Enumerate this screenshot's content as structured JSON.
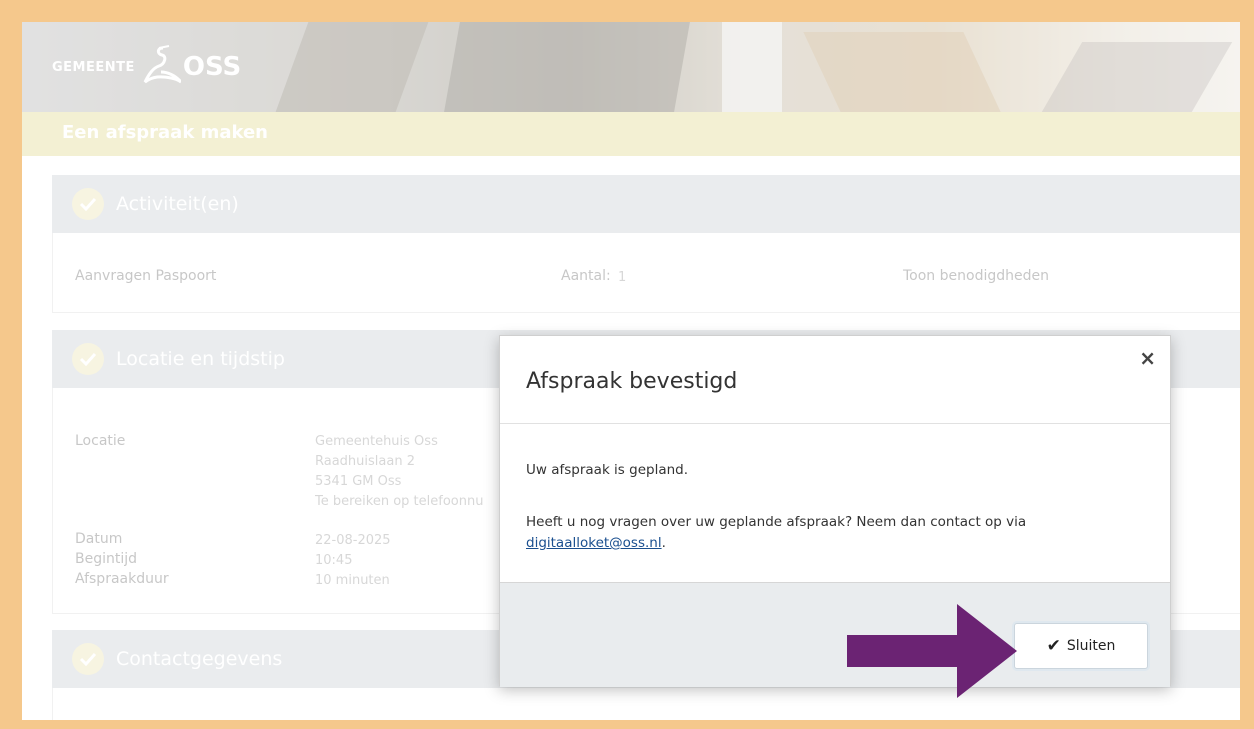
{
  "header": {
    "logo_small": "GEMEENTE",
    "logo_big": "OSS"
  },
  "page_title": "Een afspraak maken",
  "sections": {
    "activities": {
      "title": "Activiteit(en)",
      "item_label": "Aanvragen Paspoort",
      "count_label": "Aantal:",
      "count_value": "1",
      "link": "Toon benodigdheden"
    },
    "location": {
      "title": "Locatie en tijdstip",
      "location_label": "Locatie",
      "location_lines": [
        "Gemeentehuis Oss",
        "Raadhuislaan 2",
        "5341 GM Oss",
        "Te bereiken op telefoonnu"
      ],
      "date_label": "Datum",
      "date_value": "22-08-2025",
      "start_label": "Begintijd",
      "start_value": "10:45",
      "duration_label": "Afspraakduur",
      "duration_value": "10 minuten"
    },
    "contact": {
      "title": "Contactgegevens"
    }
  },
  "modal": {
    "title": "Afspraak bevestigd",
    "close_symbol": "×",
    "message": "Uw afspraak is gepland.",
    "question": "Heeft u nog vragen over uw geplande afspraak? Neem dan contact op via",
    "email": "digitaalloket@oss.nl",
    "email_suffix": ".",
    "button_label": "Sluiten"
  },
  "colors": {
    "border": "#f5c88c",
    "title_bar": "#e9e3b0",
    "panel_head": "#d9dde0",
    "arrow": "#6b2373",
    "link": "#1a4f8f"
  }
}
